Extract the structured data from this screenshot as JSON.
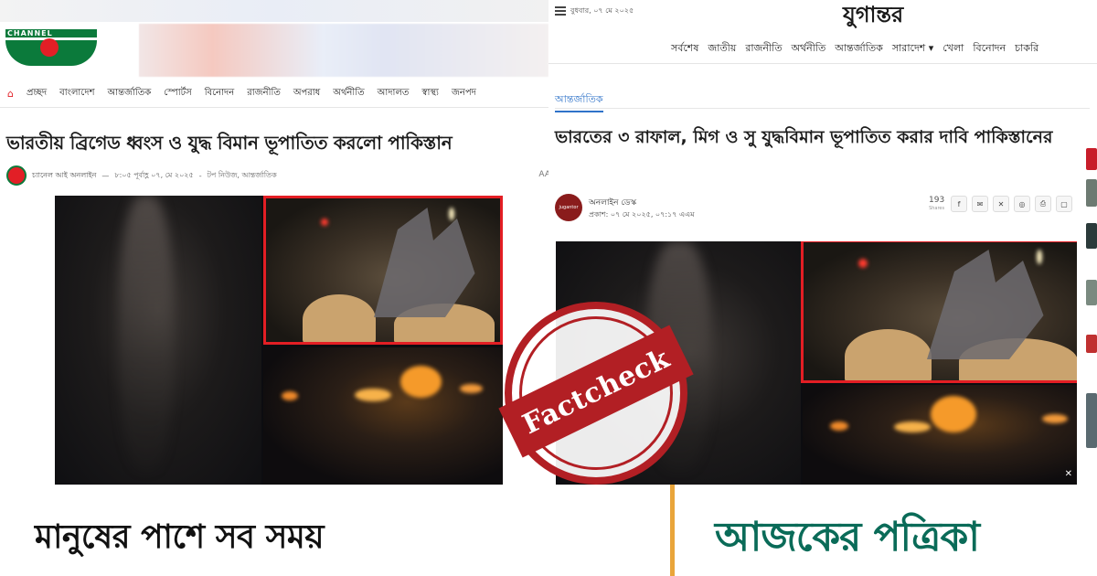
{
  "left": {
    "logo_text": "CHANNEL",
    "nav": [
      "প্রচ্ছদ",
      "বাংলাদেশ",
      "আন্তর্জাতিক",
      "স্পোর্টস",
      "বিনোদন",
      "রাজনীতি",
      "অপরাধ",
      "অর্থনীতি",
      "আদালত",
      "স্বাস্থ্য",
      "জনপদ"
    ],
    "headline": "ভারতীয় ব্রিগেড ধ্বংস ও যুদ্ধ বিমান ভূপাতিত করলো পাকিস্তান",
    "author": "চ্যানেল আই অনলাইন",
    "time": "৮:০৫ পূর্বাহ্ণ ০৭, মে ২০২৫",
    "category": "টপ নিউজ, আন্তর্জাতিক",
    "font_size_label": "AA"
  },
  "right": {
    "date": "বুধবার, ০৭ মে ২০২৫",
    "logo": "যুগান্তর",
    "nav": [
      "সর্বশেষ",
      "জাতীয়",
      "রাজনীতি",
      "অর্থনীতি",
      "আন্তর্জাতিক",
      "সারাদেশ ▾",
      "খেলা",
      "বিনোদন",
      "চাকরি"
    ],
    "tag": "আন্তর্জাতিক",
    "headline": "ভারতের ৩ রাফাল, মিগ ও সু যুদ্ধবিমান ভূপাতিত করার দাবি পাকিস্তানের",
    "author": "অনলাইন ডেস্ক",
    "published": "প্রকাশ: ০৭ মে ২০২৫, ০৭:১৭ এএম",
    "share_count": "193",
    "share_label": "Shares",
    "share_icons": [
      "f",
      "✉",
      "✕",
      "◎",
      "⎙",
      "▢"
    ],
    "avatar_text": "jugantor",
    "close_icon": "✕"
  },
  "stamp": {
    "text": "Factcheck",
    "color": "#b21f24"
  },
  "footer": {
    "slogan": "মানুষের পাশে সব সময়",
    "brand": "আজকের পত্রিকা",
    "brand_color": "#0a6b58",
    "divider_color": "#e9a53a"
  }
}
